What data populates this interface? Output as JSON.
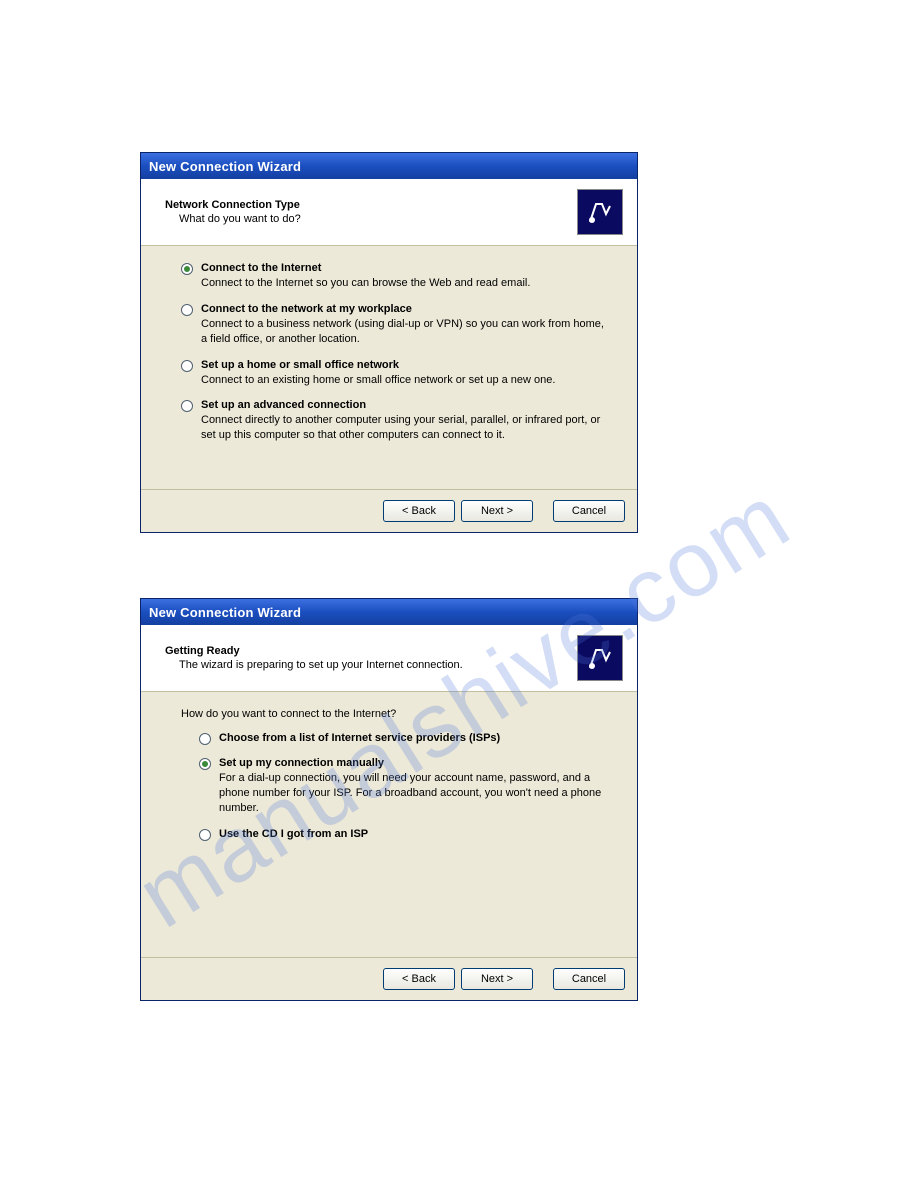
{
  "watermark": "manualshive.com",
  "wizard1": {
    "title": "New Connection Wizard",
    "header_title": "Network Connection Type",
    "header_sub": "What do you want to do?",
    "options": [
      {
        "label": "Connect to the Internet",
        "desc": "Connect to the Internet so you can browse the Web and read email.",
        "selected": true
      },
      {
        "label": "Connect to the network at my workplace",
        "desc": "Connect to a business network (using dial-up or VPN) so you can work from home, a field office, or another location.",
        "selected": false
      },
      {
        "label": "Set up a home or small office network",
        "desc": "Connect to an existing home or small office network or set up a new one.",
        "selected": false
      },
      {
        "label": "Set up an advanced connection",
        "desc": "Connect directly to another computer using your serial, parallel, or infrared port, or set up this computer so that other computers can connect to it.",
        "selected": false
      }
    ],
    "buttons": {
      "back": "< Back",
      "next": "Next >",
      "cancel": "Cancel"
    }
  },
  "wizard2": {
    "title": "New Connection Wizard",
    "header_title": "Getting Ready",
    "header_sub": "The wizard is preparing to set up your Internet connection.",
    "question": "How do you want to connect to the Internet?",
    "options": [
      {
        "label": "Choose from a list of Internet service providers (ISPs)",
        "desc": "",
        "selected": false
      },
      {
        "label": "Set up my connection manually",
        "desc": "For a dial-up connection, you will need your account name, password, and a phone number for your ISP. For a broadband account, you won't need a phone number.",
        "selected": true
      },
      {
        "label": "Use the CD I got from an ISP",
        "desc": "",
        "selected": false
      }
    ],
    "buttons": {
      "back": "< Back",
      "next": "Next >",
      "cancel": "Cancel"
    }
  }
}
